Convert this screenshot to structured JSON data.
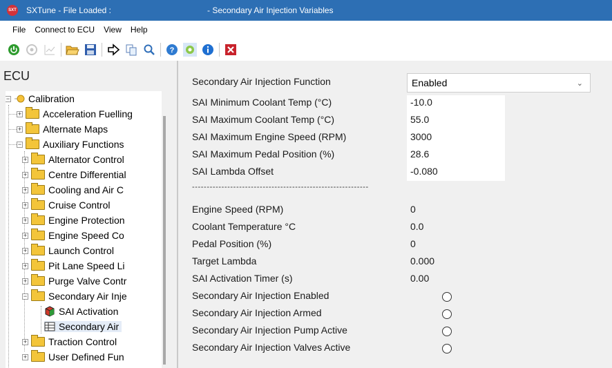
{
  "window": {
    "app_title": "SXTune - File Loaded :",
    "doc_title": "- Secondary Air Injection Variables",
    "icon_text": "SXT"
  },
  "menu": [
    "File",
    "Connect to ECU",
    "View",
    "Help"
  ],
  "toolbar": {
    "icons": [
      "power-icon",
      "connect-icon",
      "graph-icon",
      "open-folder-icon",
      "save-icon",
      "arrow-icon",
      "copy-icon",
      "search-icon",
      "help-icon",
      "settings-icon",
      "info-icon",
      "close-icon"
    ]
  },
  "left": {
    "title": "ECU",
    "tree": {
      "root": "Calibration",
      "level1": [
        "Acceleration Fuelling",
        "Alternate Maps",
        "Auxiliary Functions"
      ],
      "aux_children": [
        "Alternator Control",
        "Centre Differential",
        "Cooling and Air C",
        "Cruise Control",
        "Engine Protection",
        "Engine Speed Co",
        "Launch Control",
        "Pit Lane Speed Li",
        "Purge Valve Contr",
        "Secondary Air Inje"
      ],
      "sai_children": [
        "SAI Activation",
        "Secondary Air"
      ],
      "after": [
        "Traction Control",
        "User Defined Fun"
      ]
    }
  },
  "settings": {
    "function": {
      "label": "Secondary Air Injection Function",
      "value": "Enabled"
    },
    "rows": [
      {
        "label": "SAI Minimum Coolant Temp (°C)",
        "value": "-10.0"
      },
      {
        "label": "SAI Maximum Coolant Temp (°C)",
        "value": "55.0"
      },
      {
        "label": "SAI Maximum Engine Speed (RPM)",
        "value": "3000"
      },
      {
        "label": "SAI Maximum Pedal Position (%)",
        "value": "28.6"
      },
      {
        "label": "SAI Lambda Offset",
        "value": "-0.080"
      }
    ]
  },
  "divider": "------------------------------------------------------------",
  "live": {
    "rows": [
      {
        "label": "Engine Speed (RPM)",
        "value": "0"
      },
      {
        "label": "Coolant Temperature °C",
        "value": "0.0"
      },
      {
        "label": "Pedal Position (%)",
        "value": "0"
      },
      {
        "label": "Target Lambda",
        "value": "0.000"
      },
      {
        "label": "SAI Activation Timer (s)",
        "value": "0.00"
      }
    ],
    "status": [
      {
        "label": "Secondary Air Injection Enabled"
      },
      {
        "label": "Secondary Air Injection Armed"
      },
      {
        "label": "Secondary Air Injection Pump Active"
      },
      {
        "label": "Secondary Air Injection Valves Active"
      }
    ]
  },
  "colors": {
    "titlebar": "#2d6fb4",
    "folder": "#f3c53a",
    "close_icon": "#c8232c"
  }
}
